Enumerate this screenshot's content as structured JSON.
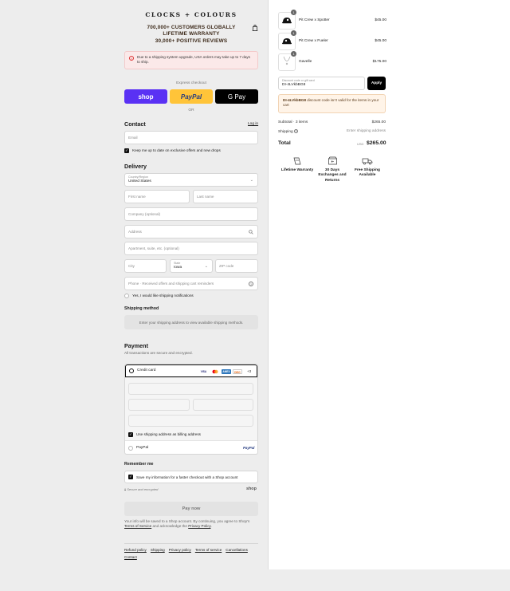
{
  "brand": {
    "logo": "CLOCKS + COLOURS",
    "promo_lines": [
      "700,000+ CUSTOMERS GLOBALLY",
      "LIFETIME WARRANTY",
      "30,000+ POSITIVE REVIEWS"
    ]
  },
  "alert": {
    "text": "Due to a shipping system upgrade, USA orders may take up to 7 days to ship."
  },
  "express": {
    "title": "Express checkout",
    "shop": "shop",
    "paypal": "PayPal",
    "gpay": "G Pay",
    "or": "OR"
  },
  "contact": {
    "title": "Contact",
    "login": "Log in",
    "email_placeholder": "Email",
    "news_label": "Keep me up to date on exclusive offers and new drops"
  },
  "delivery": {
    "title": "Delivery",
    "country_label": "Country/Region",
    "country_value": "United States",
    "first_name": "First name",
    "last_name": "Last name",
    "company": "Company (optional)",
    "address": "Address",
    "apartment": "Apartment, suite, etc. (optional)",
    "city": "City",
    "state_label": "State",
    "state_value": "Iowa",
    "zip": "ZIP code",
    "phone": "Phone · Received offers and shipping cart reminders",
    "ship_notify": "Yes, I would like shipping notifications"
  },
  "shipping_method": {
    "title": "Shipping method",
    "placeholder": "Enter your shipping address to view available shipping methods."
  },
  "payment": {
    "title": "Payment",
    "subtitle": "All transactions are secure and encrypted.",
    "credit_card": "Credit card",
    "brands": [
      "VISA",
      "MC",
      "AMEX",
      "DISC"
    ],
    "more": "+3",
    "billing_label": "Use shipping address as billing address",
    "paypal_label": "PayPal",
    "paypal_logo": "PayPal"
  },
  "remember": {
    "title": "Remember me",
    "save_label": "Save my information for a faster checkout with a Shop account",
    "secure": "Secure and encrypted",
    "shop_logo": "shop"
  },
  "pay_now": "Pay now",
  "terms": {
    "pre": "Your info will be saved to a Shop account. By continuing, you agree to Shop's",
    "tos": "Terms of Service",
    "mid": "and acknowledge the",
    "privacy": "Privacy Policy"
  },
  "footer": [
    "Refund policy",
    "Shipping",
    "Privacy policy",
    "Terms of service",
    "Cancellations",
    "Contact"
  ],
  "cart": {
    "items": [
      {
        "qty": "1",
        "name": "Pit Crew x Spotter",
        "price": "$45.00"
      },
      {
        "qty": "1",
        "name": "Pit Crew x Fueler",
        "price": "$45.00"
      },
      {
        "qty": "1",
        "name": "Gavelle",
        "price": "$175.00"
      }
    ],
    "discount_label": "Discount code or gift card",
    "discount_value": "DI-4LVkbBG8",
    "apply": "Apply",
    "discount_error_code": "DI-4LVkbBG8",
    "discount_error_text": "discount code isn't valid for the items in your cart",
    "subtotal_label": "Subtotal · 3 items",
    "subtotal_value": "$265.00",
    "shipping_label": "Shipping",
    "shipping_value": "Enter shipping address",
    "total_label": "Total",
    "total_currency": "USD",
    "total_value": "$265.00"
  },
  "perks": [
    {
      "icon": "warranty-icon",
      "label": "Lifetime Warranty"
    },
    {
      "icon": "box-return-icon",
      "label": "30 Days Exchanges and Returns"
    },
    {
      "icon": "truck-icon",
      "label": "Free Shipping Available"
    }
  ],
  "colors": {
    "shop": "#5a31f4",
    "paypal": "#ffc439",
    "gpay": "#000000",
    "error_bg": "#fbe9e9",
    "warn_bg": "#fff4e8"
  }
}
